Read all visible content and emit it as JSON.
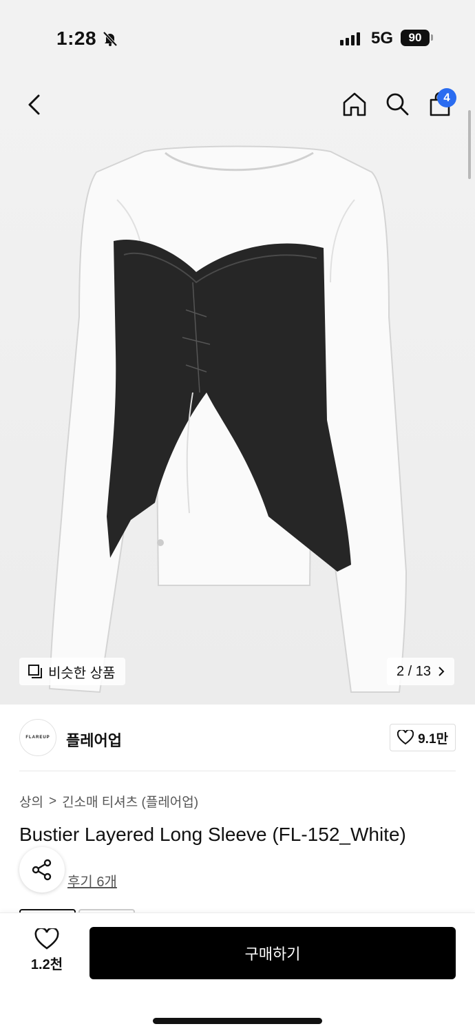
{
  "status_bar": {
    "time": "1:28",
    "network": "5G",
    "battery": "90"
  },
  "header": {
    "cart_count": "4"
  },
  "gallery": {
    "similar_label": "비슷한 상품",
    "page_indicator": "2 / 13"
  },
  "brand": {
    "logo_text": "FLAREUP",
    "name": "플레어업",
    "like_count": "9.1만"
  },
  "breadcrumb": {
    "category": "상의",
    "separator": ">",
    "subcategory": "긴소매 티셔츠 (플레어업)"
  },
  "product": {
    "title": "Bustier Layered Long Sleeve (FL-152_White)",
    "review_link": "후기 6개"
  },
  "bottom_bar": {
    "wish_count": "1.2천",
    "buy_label": "구매하기"
  },
  "colors": {
    "accent_badge": "#2a6cf0",
    "buy_button": "#000000"
  }
}
